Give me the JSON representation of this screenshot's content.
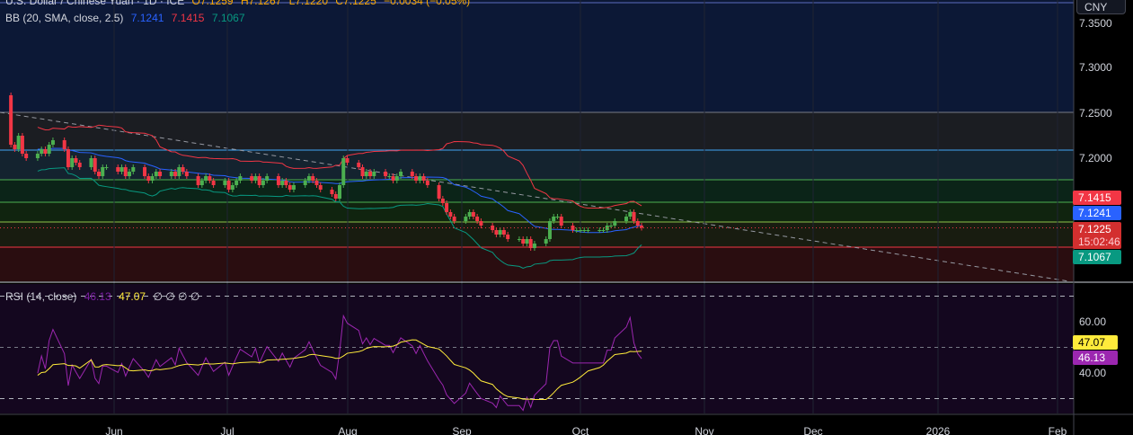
{
  "header": {
    "symbol": "U.S. Dollar / Chinese Yuan · 1D · ICE",
    "open": "O7.1259",
    "high": "H7.1267",
    "low": "L7.1220",
    "close": "C7.1225",
    "change": "−0.0034 (−0.05%)"
  },
  "bb_legend": {
    "label": "BB (20, SMA, close, 2.5)",
    "basis": "7.1241",
    "upper": "7.1415",
    "lower": "7.1067"
  },
  "rsi_legend": {
    "label": "RSI (14, close)",
    "rsi": "46.13",
    "ma": "47.07",
    "extra": "∅ ∅ ∅ ∅"
  },
  "currency": "CNY",
  "price_axis": [
    "7.3500",
    "7.3000",
    "7.2500",
    "7.2000"
  ],
  "price_tags": {
    "upper": "7.1415",
    "basis": "7.1241",
    "last": "7.1225",
    "countdown": "15:02:46",
    "lower": "7.1067"
  },
  "rsi_axis": [
    "60.00",
    "40.00"
  ],
  "rsi_tags": {
    "ma": "47.07",
    "rsi": "46.13"
  },
  "colors": {
    "up": "#26a69a",
    "green": "#4caf50",
    "down": "#f23645",
    "upper": "#f23645",
    "basis": "#2962ff",
    "lower": "#089981",
    "rsi": "#9c27b0",
    "rsima": "#ffeb3b"
  },
  "chart_data": {
    "type": "candlestick",
    "title": "U.S. Dollar / Chinese Yuan · 1D · ICE",
    "start_date": "2025-05-05",
    "ylim": [
      7.08,
      7.37
    ],
    "x_ticks": [
      "Jun",
      "Jul",
      "Aug",
      "Sep",
      "Oct",
      "Nov",
      "Dec",
      "2026",
      "Feb"
    ],
    "closes": [
      7.215,
      7.21,
      7.225,
      7.205,
      7.2,
      7.205,
      7.21,
      7.205,
      7.215,
      7.22,
      7.21,
      7.19,
      7.2,
      7.195,
      7.19,
      7.2,
      7.185,
      7.18,
      7.19,
      7.19,
      7.185,
      7.19,
      7.18,
      7.185,
      7.19,
      7.18,
      7.175,
      7.18,
      7.185,
      7.18,
      7.185,
      7.18,
      7.19,
      7.185,
      7.18,
      7.17,
      7.175,
      7.18,
      7.175,
      7.17,
      7.175,
      7.165,
      7.17,
      7.175,
      7.18,
      7.175,
      7.18,
      7.17,
      7.175,
      7.18,
      7.17,
      7.175,
      7.17,
      7.165,
      7.17,
      7.175,
      7.18,
      7.175,
      7.17,
      7.165,
      7.16,
      7.155,
      7.17,
      7.2,
      7.195,
      7.19,
      7.18,
      7.185,
      7.18,
      7.185,
      7.18,
      7.18,
      7.175,
      7.18,
      7.185,
      7.18,
      7.175,
      7.18,
      7.175,
      7.17,
      7.155,
      7.15,
      7.14,
      7.135,
      7.13,
      7.135,
      7.14,
      7.135,
      7.13,
      7.125,
      7.12,
      7.115,
      7.12,
      7.115,
      7.11,
      7.11,
      7.105,
      7.11,
      7.1,
      7.105,
      7.11,
      7.13,
      7.135,
      7.135,
      7.125,
      7.12,
      7.12,
      7.12,
      7.12,
      7.12,
      7.12,
      7.12,
      7.125,
      7.125,
      7.13,
      7.135,
      7.14,
      7.13,
      7.125,
      7.1225
    ],
    "first_open": 7.27,
    "rsi_range": [
      20,
      80
    ]
  }
}
